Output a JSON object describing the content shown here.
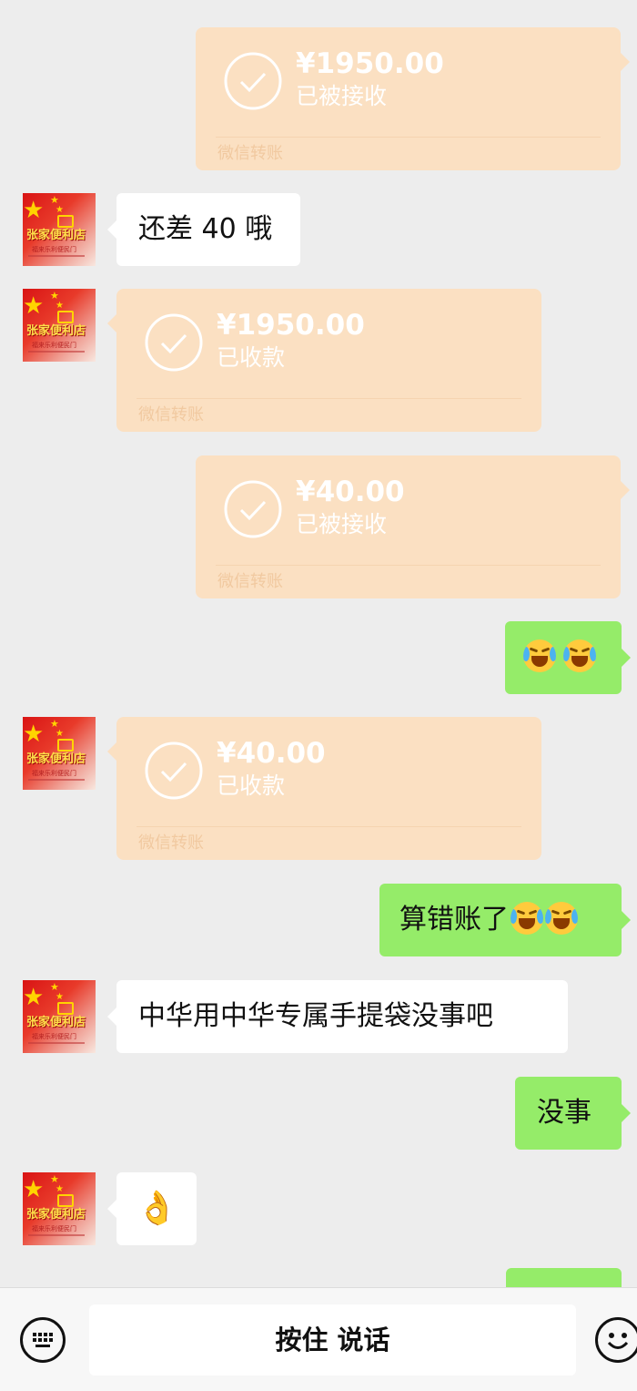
{
  "contact": {
    "avatar": {
      "name": "张家便利店",
      "slogan": "福来乐利便民门"
    }
  },
  "messages": [
    {
      "type": "transfer",
      "side": "right",
      "amount": "¥1950.00",
      "status": "已被接收",
      "brand": "微信转账"
    },
    {
      "type": "text",
      "side": "left",
      "text": "还差 40 哦"
    },
    {
      "type": "transfer",
      "side": "left",
      "amount": "¥1950.00",
      "status": "已收款",
      "brand": "微信转账"
    },
    {
      "type": "transfer",
      "side": "right",
      "amount": "¥40.00",
      "status": "已被接收",
      "brand": "微信转账"
    },
    {
      "type": "emoji",
      "side": "right",
      "emojis": [
        "laughing-crying-emoji",
        "laughing-crying-emoji"
      ]
    },
    {
      "type": "transfer",
      "side": "left",
      "amount": "¥40.00",
      "status": "已收款",
      "brand": "微信转账"
    },
    {
      "type": "text",
      "side": "right",
      "text": "算错账了",
      "emojis": [
        "laughing-crying-emoji",
        "laughing-crying-emoji"
      ]
    },
    {
      "type": "text",
      "side": "left",
      "text": "中华用中华专属手提袋没事吧"
    },
    {
      "type": "text",
      "side": "right",
      "text": "没事"
    },
    {
      "type": "emoji",
      "side": "left",
      "emojis": [
        "ok-hand-emoji"
      ],
      "glyph": "👌"
    }
  ],
  "input_bar": {
    "voice_label": "按住 说话",
    "left_icon": "keyboard-icon",
    "right_icon": "emoji-face-icon"
  },
  "colors": {
    "background": "#ededed",
    "bubble_self": "#95ec69",
    "bubble_other": "#ffffff",
    "transfer_card": "#fbe0c2"
  }
}
